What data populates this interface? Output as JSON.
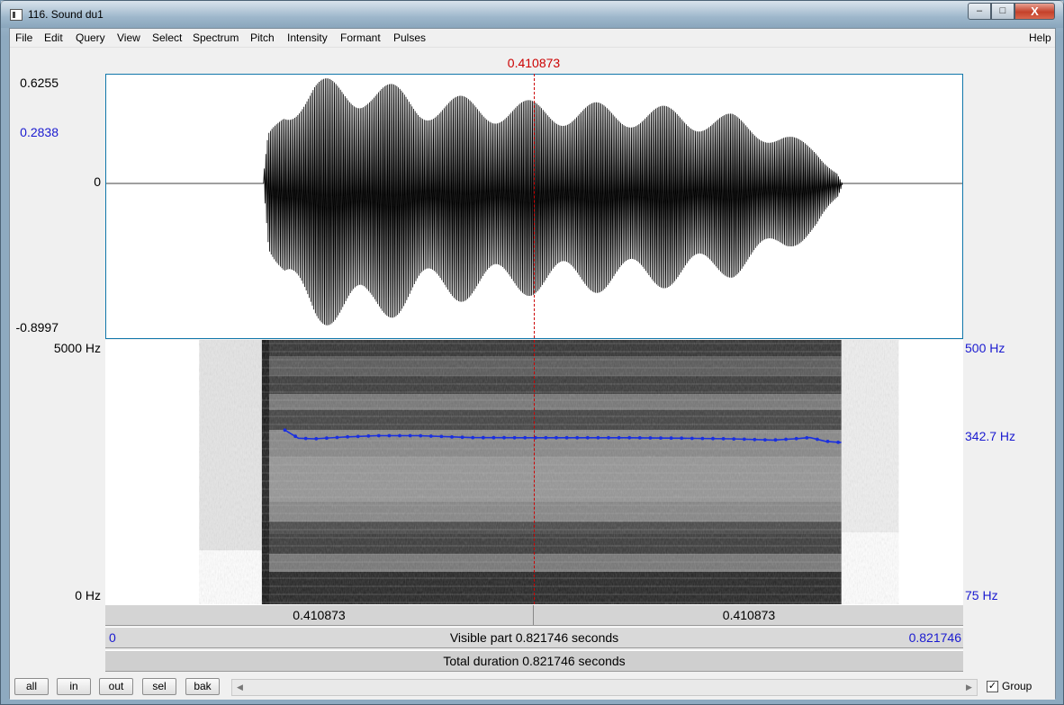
{
  "window": {
    "title": "116. Sound du1",
    "controls": {
      "minimize": "–",
      "maximize": "□",
      "close": "X"
    }
  },
  "menu": {
    "items": [
      "File",
      "Edit",
      "Query",
      "View",
      "Select",
      "Spectrum",
      "Pitch",
      "Intensity",
      "Formant",
      "Pulses"
    ],
    "help": "Help"
  },
  "editor": {
    "cursor_time": "0.410873",
    "wave_axis": {
      "top": "0.6255",
      "mark": "0.2838",
      "zero": "0",
      "bottom": "-0.8997"
    },
    "spec_axis": {
      "top": "5000 Hz",
      "bottom": "0 Hz"
    },
    "pitch_axis": {
      "top": "500 Hz",
      "mark": "342.7 Hz",
      "bottom": "75 Hz"
    },
    "selection": {
      "left": "0.410873",
      "right": "0.410873"
    },
    "visible": {
      "start": "0",
      "label": "Visible part 0.821746 seconds",
      "end": "0.821746"
    },
    "total": {
      "label": "Total duration 0.821746 seconds"
    }
  },
  "buttons": {
    "all": "all",
    "in": "in",
    "out": "out",
    "sel": "sel",
    "bak": "bak"
  },
  "scroll": {
    "left_arrow": "◀",
    "right_arrow": "▶"
  },
  "group": {
    "checked": "✓",
    "label": "Group"
  },
  "colors": {
    "cursor": "#cc0000",
    "pitch": "#1a2fe0",
    "axis_blue": "#1a1ad0"
  },
  "chart_data": {
    "type": "line",
    "x_range": [
      0,
      0.821746
    ],
    "pitch_range_hz": [
      75,
      500
    ],
    "pitch_curve_hz": [
      [
        0.172,
        355
      ],
      [
        0.185,
        342
      ],
      [
        0.2,
        341
      ],
      [
        0.23,
        344
      ],
      [
        0.26,
        346
      ],
      [
        0.3,
        346
      ],
      [
        0.35,
        343
      ],
      [
        0.4,
        342.7
      ],
      [
        0.45,
        342.7
      ],
      [
        0.5,
        342.7
      ],
      [
        0.55,
        342
      ],
      [
        0.6,
        341
      ],
      [
        0.64,
        339
      ],
      [
        0.66,
        341
      ],
      [
        0.675,
        343
      ],
      [
        0.69,
        337
      ],
      [
        0.705,
        335
      ]
    ],
    "wave_range": [
      -0.8997,
      0.6255
    ],
    "wave_envelope": [
      [
        0.15,
        0.0
      ],
      [
        0.155,
        0.3
      ],
      [
        0.17,
        0.5
      ],
      [
        0.2,
        0.6
      ],
      [
        0.25,
        0.62
      ],
      [
        0.3,
        0.52
      ],
      [
        0.4,
        0.48
      ],
      [
        0.5,
        0.46
      ],
      [
        0.55,
        0.44
      ],
      [
        0.6,
        0.4
      ],
      [
        0.65,
        0.3
      ],
      [
        0.68,
        0.2
      ],
      [
        0.7,
        0.08
      ],
      [
        0.705,
        0.0
      ]
    ]
  }
}
